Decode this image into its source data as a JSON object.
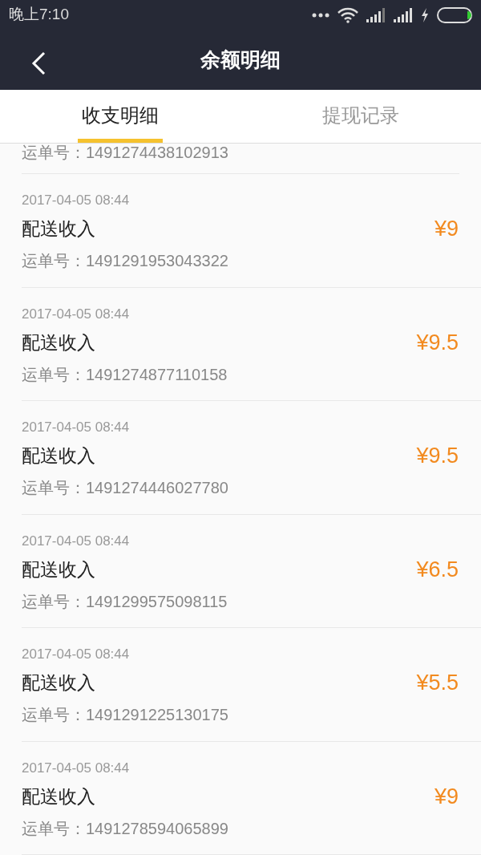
{
  "status_bar": {
    "time": "晚上7:10"
  },
  "header": {
    "title": "余额明细"
  },
  "tabs": [
    {
      "label": "收支明细",
      "selected": true
    },
    {
      "label": "提现记录",
      "selected": false
    }
  ],
  "records": [
    {
      "kind": "partial",
      "order_no": "运单号：1491274438102913"
    },
    {
      "kind": "full",
      "time": "2017-04-05 08:44",
      "title": "配送收入",
      "amount": "¥9",
      "order_no": "运单号：1491291953043322"
    },
    {
      "kind": "full",
      "time": "2017-04-05 08:44",
      "title": "配送收入",
      "amount": "¥9.5",
      "order_no": "运单号：1491274877110158"
    },
    {
      "kind": "full",
      "time": "2017-04-05 08:44",
      "title": "配送收入",
      "amount": "¥9.5",
      "order_no": "运单号：1491274446027780"
    },
    {
      "kind": "full",
      "time": "2017-04-05 08:44",
      "title": "配送收入",
      "amount": "¥6.5",
      "order_no": "运单号：1491299575098115"
    },
    {
      "kind": "full",
      "time": "2017-04-05 08:44",
      "title": "配送收入",
      "amount": "¥5.5",
      "order_no": "运单号：1491291225130175"
    },
    {
      "kind": "full",
      "time": "2017-04-05 08:44",
      "title": "配送收入",
      "amount": "¥9",
      "order_no": "运单号：1491278594065899"
    }
  ]
}
